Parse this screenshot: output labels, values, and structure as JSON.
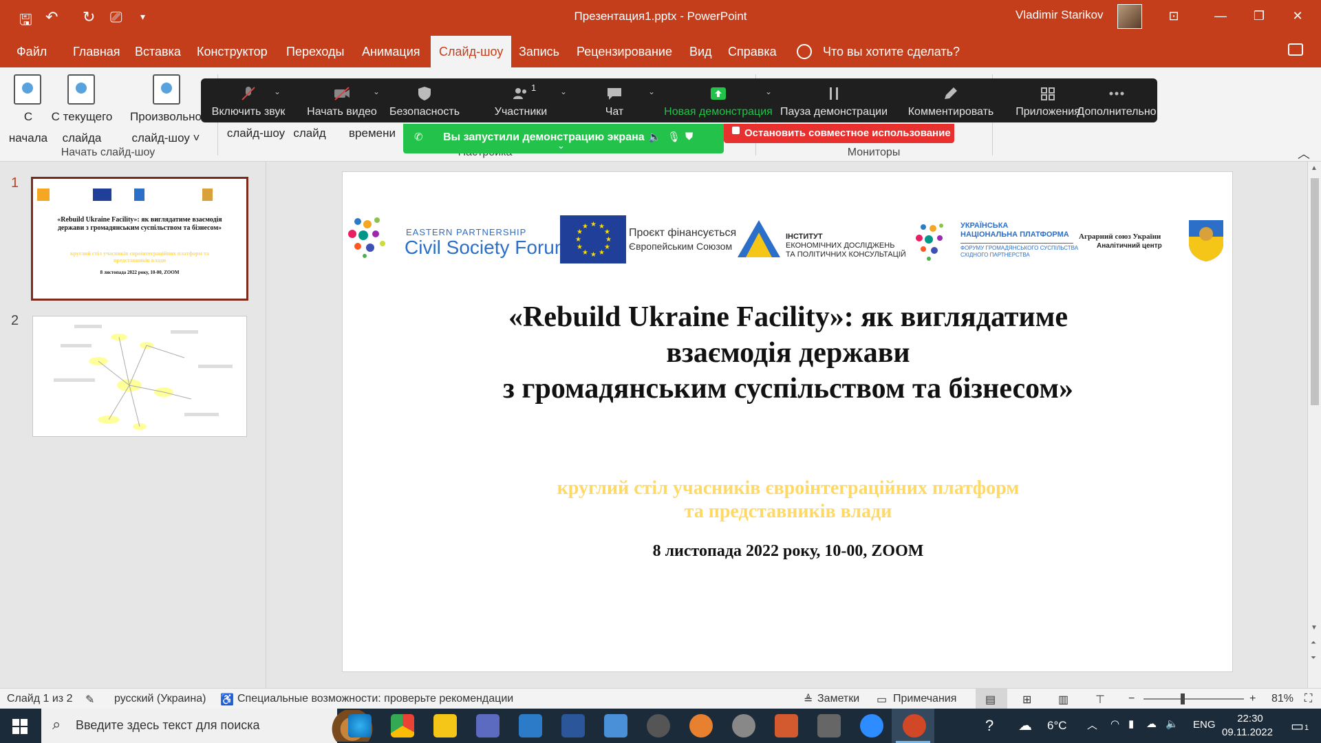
{
  "titlebar": {
    "title": "Презентация1.pptx  -  PowerPoint",
    "user": "Vladimir Starikov"
  },
  "tabs": [
    "Файл",
    "Главная",
    "Вставка",
    "Конструктор",
    "Переходы",
    "Анимация",
    "Слайд-шоу",
    "Запись",
    "Рецензирование",
    "Вид",
    "Справка"
  ],
  "tell_me": "Что вы хотите сделать?",
  "ribbon": {
    "from_start": [
      "С",
      "начала"
    ],
    "from_current": [
      "С текущего",
      "слайда"
    ],
    "custom": [
      "Произвольно",
      "слайд-шоу ˅"
    ],
    "slideshow": "слайд-шоу",
    "slide": "слайд",
    "timings": "времени",
    "group_start": "Начать слайд-шоу",
    "group_setup": "Настройка",
    "group_monitors": "Мониторы"
  },
  "zoom": {
    "mute": "Включить звук",
    "video": "Начать видео",
    "security": "Безопасность",
    "participants": "Участники",
    "participants_count": "1",
    "chat": "Чат",
    "new_share": "Новая демонстрация",
    "pause_share": "Пауза демонстрации",
    "annotate": "Комментировать",
    "apps": "Приложения",
    "more": "Дополнительно",
    "sharing_banner": "Вы запустили демонстрацию экрана",
    "stop_share": "Остановить совместное использование"
  },
  "thumbnails": [
    {
      "num": "1",
      "title": "«Rebuild Ukraine Facility»: як виглядатиме взаємодія держави з громадянським суспільством та бізнесом»",
      "sub": "круглий стіл учасників євроінтеграційних платформ та представників влади",
      "date": "8 листопада 2022 року, 10-00, ZOOM"
    },
    {
      "num": "2"
    }
  ],
  "slide": {
    "logos": {
      "eap_small": "EASTERN PARTNERSHIP",
      "eap_big": "Civil Society Forum",
      "eu_text1": "Проєкт фінансується",
      "eu_text2": "Європейським Союзом",
      "ier1": "ІНСТИТУТ",
      "ier2": "ЕКОНОМІЧНИХ ДОСЛІДЖЕНЬ",
      "ier3": "ТА ПОЛІТИЧНИХ КОНСУЛЬТАЦІЙ",
      "unp1": "УКРАЇНСЬКА",
      "unp2": "НАЦІОНАЛЬНА ПЛАТФОРМА",
      "unp3": "ФОРУМУ ГРОМАДЯНСЬКОГО СУСПІЛЬСТВА",
      "unp4": "СХІДНОГО ПАРТНЕРСТВА",
      "agro1": "Аграрний союз України",
      "agro2": "Аналітичний центр"
    },
    "title_line1": "«Rebuild Ukraine Facility»: як виглядатиме",
    "title_line2": "взаємодія держави",
    "title_line3": "з громадянським суспільством та бізнесом»",
    "subtitle_line1": "круглий стіл учасників євроінтеграційних платформ",
    "subtitle_line2": "та представників влади",
    "date": "8 листопада 2022 року, 10-00, ZOOM"
  },
  "statusbar": {
    "slide_counter": "Слайд 1 из 2",
    "language": "русский (Украина)",
    "accessibility": "Специальные возможности: проверьте рекомендации",
    "notes": "Заметки",
    "comments": "Примечания",
    "zoom_minus": "−",
    "zoom_plus": "+",
    "zoom_level": "81%"
  },
  "taskbar": {
    "search_placeholder": "Введите здесь текст для поиска",
    "temp": "6°C",
    "lang": "ENG",
    "time": "22:30",
    "date": "09.11.2022",
    "notif_count": "1"
  },
  "colors": {
    "ppt_accent": "#c43e1c",
    "zoom_green": "#23c24a",
    "zoom_red": "#e8312f",
    "subtitle_yellow": "#ffd966"
  }
}
